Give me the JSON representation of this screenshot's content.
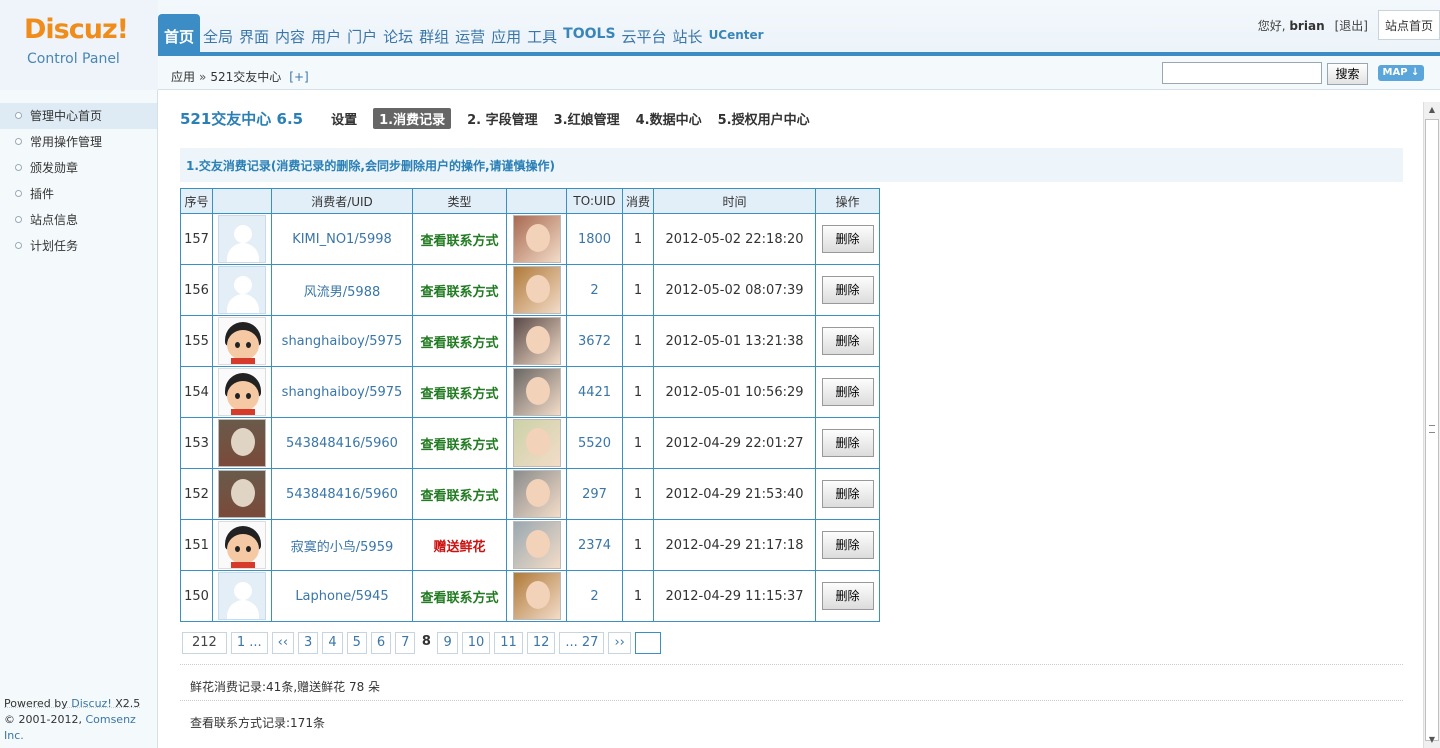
{
  "logo": {
    "main": "Discuz!",
    "sub": "Control Panel"
  },
  "nav": [
    {
      "label": "首页",
      "style": "active"
    },
    {
      "label": "全局",
      "style": ""
    },
    {
      "label": "界面",
      "style": ""
    },
    {
      "label": "内容",
      "style": ""
    },
    {
      "label": "用户",
      "style": ""
    },
    {
      "label": "门户",
      "style": ""
    },
    {
      "label": "论坛",
      "style": ""
    },
    {
      "label": "群组",
      "style": ""
    },
    {
      "label": "运营",
      "style": ""
    },
    {
      "label": "应用",
      "style": ""
    },
    {
      "label": "工具",
      "style": ""
    },
    {
      "label": "TOOLS",
      "style": "bold"
    },
    {
      "label": "云平台",
      "style": ""
    },
    {
      "label": "站长",
      "style": ""
    },
    {
      "label": "UCenter",
      "style": "small"
    }
  ],
  "topright": {
    "greeting_prefix": "您好,",
    "username": "brian",
    "logout": "[退出]",
    "site_home": "站点首页"
  },
  "breadcrumb": {
    "root": "应用",
    "sep": "»",
    "current": "521交友中心",
    "add": "[+]"
  },
  "search": {
    "value": "",
    "button": "搜索",
    "map": "MAP ↓"
  },
  "sidebar": {
    "items": [
      "管理中心首页",
      "常用操作管理",
      "颁发勋章",
      "插件",
      "站点信息",
      "计划任务"
    ],
    "powered_prefix": "Powered by ",
    "powered_link": "Discuz!",
    "powered_version": " X2.5",
    "copyright_prefix": "© 2001-2012, ",
    "copyright_link": "Comsenz Inc."
  },
  "plugin": {
    "title": "521交友中心 6.5",
    "tabs": [
      "设置",
      "1.消费记录",
      "2. 字段管理",
      "3.红娘管理",
      "4.数据中心",
      "5.授权用户中心"
    ],
    "active_tab": 1
  },
  "section_title": "1.交友消费记录(消费记录的删除,会同步删除用户的操作,请谨慎操作)",
  "table": {
    "headers": [
      "序号",
      "",
      "消费者/UID",
      "类型",
      "",
      "TO:UID",
      "消费",
      "时间",
      "操作"
    ],
    "rows": [
      {
        "id": "157",
        "avatar": "default",
        "user": "KIMI_NO1/5998",
        "type": "查看联系方式",
        "type_color": "green",
        "photo": "#a86a52",
        "to_uid": "1800",
        "cost": "1",
        "time": "2012-05-02 22:18:20",
        "action": "删除"
      },
      {
        "id": "156",
        "avatar": "default",
        "user": "风流男/5988",
        "type": "查看联系方式",
        "type_color": "green",
        "photo": "#b07a3a",
        "to_uid": "2",
        "cost": "1",
        "time": "2012-05-02 08:07:39",
        "action": "删除"
      },
      {
        "id": "155",
        "avatar": "cartoon",
        "user": "shanghaiboy/5975",
        "type": "查看联系方式",
        "type_color": "green",
        "photo": "#5a4a48",
        "to_uid": "3672",
        "cost": "1",
        "time": "2012-05-01 13:21:38",
        "action": "删除"
      },
      {
        "id": "154",
        "avatar": "cartoon",
        "user": "shanghaiboy/5975",
        "type": "查看联系方式",
        "type_color": "green",
        "photo": "#6a6664",
        "to_uid": "4421",
        "cost": "1",
        "time": "2012-05-01 10:56:29",
        "action": "删除"
      },
      {
        "id": "153",
        "avatar": "photo",
        "avatar_color": "#7a4a3a",
        "user": "543848416/5960",
        "type": "查看联系方式",
        "type_color": "green",
        "photo": "#cbd2a8",
        "to_uid": "5520",
        "cost": "1",
        "time": "2012-04-29 22:01:27",
        "action": "删除"
      },
      {
        "id": "152",
        "avatar": "photo",
        "avatar_color": "#7a4a3a",
        "user": "543848416/5960",
        "type": "查看联系方式",
        "type_color": "green",
        "photo": "#8c8c8c",
        "to_uid": "297",
        "cost": "1",
        "time": "2012-04-29 21:53:40",
        "action": "删除"
      },
      {
        "id": "151",
        "avatar": "cartoon",
        "user": "寂寞的小鸟/5959",
        "type": "赠送鲜花",
        "type_color": "red",
        "photo": "#9aa8b0",
        "to_uid": "2374",
        "cost": "1",
        "time": "2012-04-29 21:17:18",
        "action": "删除"
      },
      {
        "id": "150",
        "avatar": "default",
        "user": "Laphone/5945",
        "type": "查看联系方式",
        "type_color": "green",
        "photo": "#b07a3a",
        "to_uid": "2",
        "cost": "1",
        "time": "2012-04-29 11:15:37",
        "action": "删除"
      }
    ]
  },
  "pager": {
    "total": "212",
    "items": [
      "1 ...",
      "‹‹",
      "3",
      "4",
      "5",
      "6",
      "7",
      "8",
      "9",
      "10",
      "11",
      "12",
      "... 27",
      "››"
    ],
    "current": "8",
    "jump_value": ""
  },
  "summary": {
    "flowers": "鲜花消费记录:41条,赠送鲜花 78 朵",
    "contacts": "查看联系方式记录:171条"
  },
  "colors": {
    "accent": "#3c8cc6",
    "link": "#3a76a8",
    "green": "#227b22",
    "red": "#cc1111",
    "logo": "#f08c1a"
  }
}
